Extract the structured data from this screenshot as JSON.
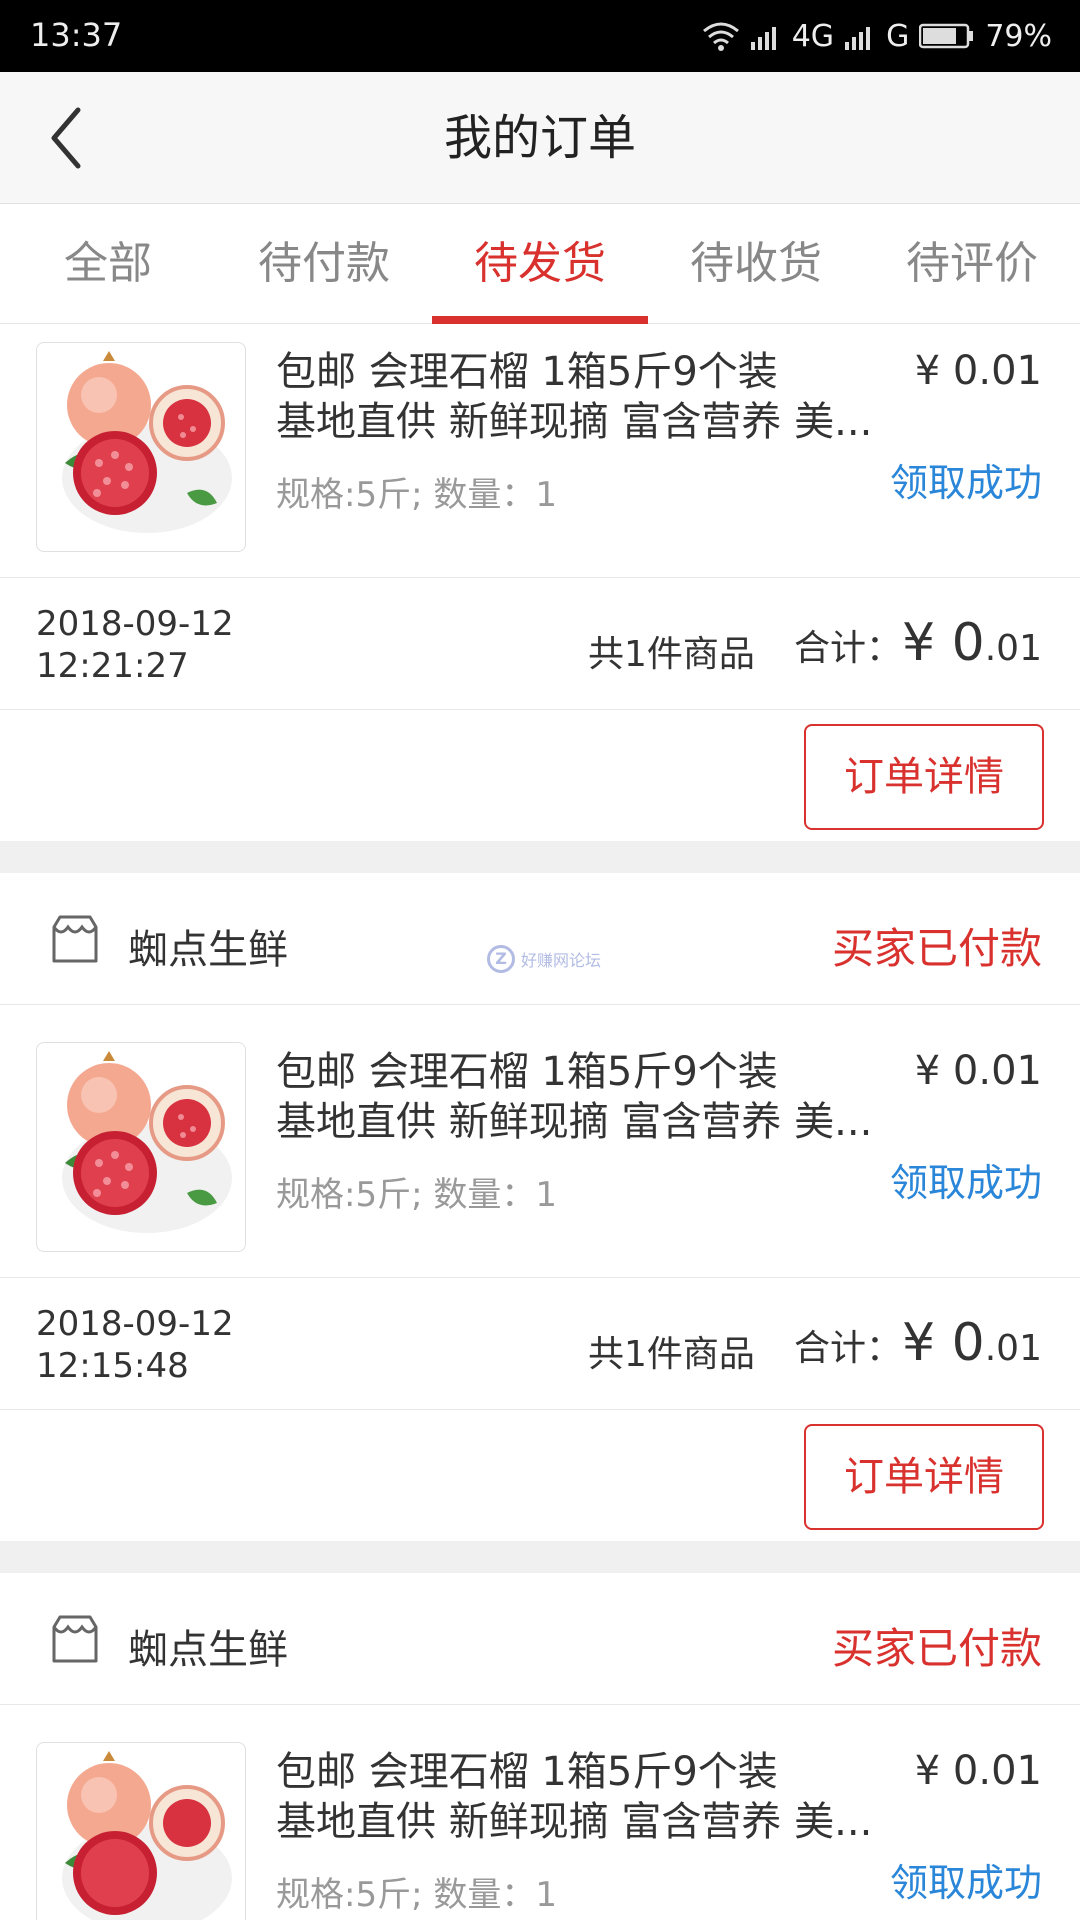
{
  "status_bar": {
    "time": "13:37",
    "network_4g": "4G",
    "network_g": "G",
    "battery": "79%"
  },
  "header": {
    "title": "我的订单",
    "back_icon": "chevron-left-icon"
  },
  "tabs": [
    {
      "label": "全部",
      "active": false
    },
    {
      "label": "待付款",
      "active": false
    },
    {
      "label": "待发货",
      "active": true
    },
    {
      "label": "待收货",
      "active": false
    },
    {
      "label": "待评价",
      "active": false
    }
  ],
  "orders": [
    {
      "store": null,
      "product": {
        "name_line1": "包邮 会理石榴 1箱5斤9个装",
        "name_line2": "基地直供 新鲜现摘 富含营养 美...",
        "spec": "规格:5斤; 数量：1",
        "price": "¥ 0.01",
        "status": "领取成功"
      },
      "time_date": "2018-09-12",
      "time_clock": "12:21:27",
      "count": "共1件商品",
      "total_label": "合计：",
      "total_symbol": "¥ ",
      "total_int": "0",
      "total_dec": ".01",
      "detail_button": "订单详情"
    },
    {
      "store": {
        "name": "蜘点生鲜",
        "status": "买家已付款"
      },
      "product": {
        "name_line1": "包邮 会理石榴 1箱5斤9个装",
        "name_line2": "基地直供 新鲜现摘 富含营养 美...",
        "spec": "规格:5斤; 数量：1",
        "price": "¥ 0.01",
        "status": "领取成功"
      },
      "time_date": "2018-09-12",
      "time_clock": "12:15:48",
      "count": "共1件商品",
      "total_label": "合计：",
      "total_symbol": "¥ ",
      "total_int": "0",
      "total_dec": ".01",
      "detail_button": "订单详情"
    },
    {
      "store": {
        "name": "蜘点生鲜",
        "status": "买家已付款"
      },
      "product": {
        "name_line1": "包邮 会理石榴 1箱5斤9个装",
        "name_line2": "基地直供 新鲜现摘 富含营养 美...",
        "spec": "规格:5斤; 数量：1",
        "price": "¥ 0.01",
        "status": "领取成功"
      }
    }
  ],
  "watermark": {
    "text": "好赚网论坛"
  },
  "colors": {
    "accent": "#d8312e",
    "link_blue": "#2a86d8",
    "gap": "#f0f0f0"
  }
}
